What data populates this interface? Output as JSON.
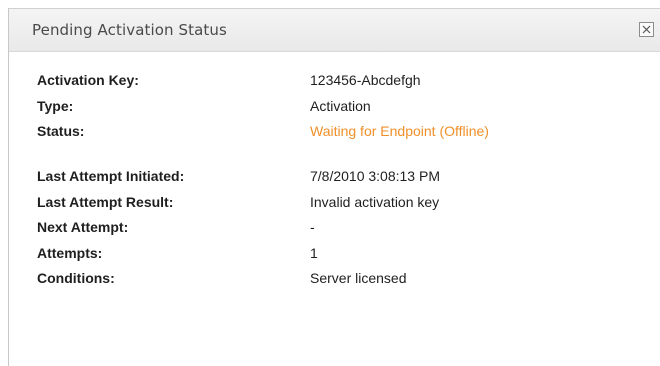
{
  "dialog": {
    "title": "Pending Activation Status",
    "close_icon": "close-icon"
  },
  "details": [
    {
      "label": "Activation Key:",
      "value": "123456-Abcdefgh"
    },
    {
      "label": "Type:",
      "value": "Activation"
    },
    {
      "label": "Status:",
      "value": "Waiting for Endpoint (Offline)"
    },
    {
      "label": "Last Attempt Initiated:",
      "value": "7/8/2010 3:08:13 PM"
    },
    {
      "label": "Last Attempt Result:",
      "value": "Invalid activation key"
    },
    {
      "label": "Next Attempt:",
      "value": "-"
    },
    {
      "label": "Attempts:",
      "value": "1"
    },
    {
      "label": "Conditions:",
      "value": "Server licensed"
    }
  ],
  "colors": {
    "status_text": "#f0902a",
    "title_text": "#4a4a4a"
  }
}
